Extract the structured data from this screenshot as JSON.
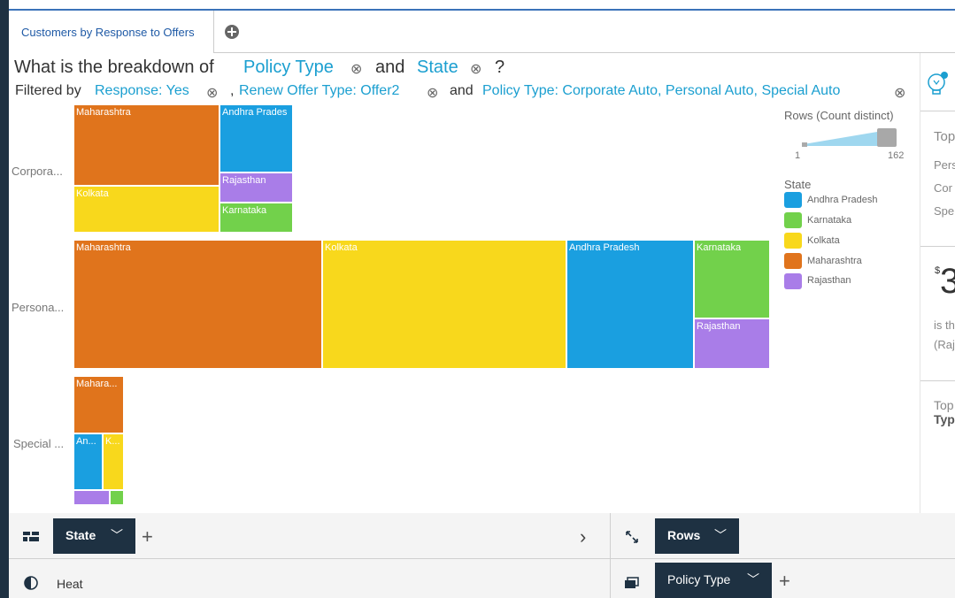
{
  "tab": {
    "title": "Customers by Response to Offers"
  },
  "question": {
    "prefix": "What is the breakdown of",
    "field1": "Policy Type",
    "and": "and",
    "field2": "State",
    "suffix": "?"
  },
  "filters": {
    "prefix": "Filtered by",
    "f1": "Response: Yes",
    "sep1": ",",
    "f2": "Renew Offer Type: Offer2",
    "and": "and",
    "f3": "Policy Type: Corporate Auto, Personal Auto, Special Auto"
  },
  "rows": {
    "corporate": "Corpora...",
    "personal": "Persona...",
    "special": "Special ..."
  },
  "treemap": {
    "corporate": {
      "maharashtra": "Maharashtra",
      "andhra": "Andhra Prades",
      "kolkata": "Kolkata",
      "rajasthan": "Rajasthan",
      "karnataka": "Karnataka"
    },
    "personal": {
      "maharashtra": "Maharashtra",
      "kolkata": "Kolkata",
      "andhra": "Andhra Pradesh",
      "karnataka": "Karnataka",
      "rajasthan": "Rajasthan"
    },
    "special": {
      "maharashtra": "Mahara...",
      "andhra": "An...",
      "kolkata": "K..."
    }
  },
  "slider": {
    "title": "Rows (Count distinct)",
    "min": "1",
    "max": "162"
  },
  "legend": {
    "title": "State",
    "items": [
      {
        "label": "Andhra Pradesh",
        "color": "#1a9fe0"
      },
      {
        "label": "Karnataka",
        "color": "#72d14b"
      },
      {
        "label": "Kolkata",
        "color": "#f8d81c"
      },
      {
        "label": "Maharashtra",
        "color": "#e0741c"
      },
      {
        "label": "Rajasthan",
        "color": "#a97de8"
      }
    ]
  },
  "right_panel": {
    "t1": "Top",
    "l1": "Pers",
    "l2": "Cor",
    "l3": "Spe",
    "big": "3",
    "currency": "$",
    "is": "is th",
    "raj": "(Raj",
    "t2": "Top",
    "t3": "Typ"
  },
  "bottom": {
    "state_pill": "State",
    "rows_pill": "Rows",
    "heat_label": "Heat",
    "policy_pill": "Policy Type"
  },
  "colors": {
    "andhra": "#1a9fe0",
    "karnataka": "#72d14b",
    "kolkata": "#f8d81c",
    "maharashtra": "#e0741c",
    "rajasthan": "#a97de8"
  }
}
